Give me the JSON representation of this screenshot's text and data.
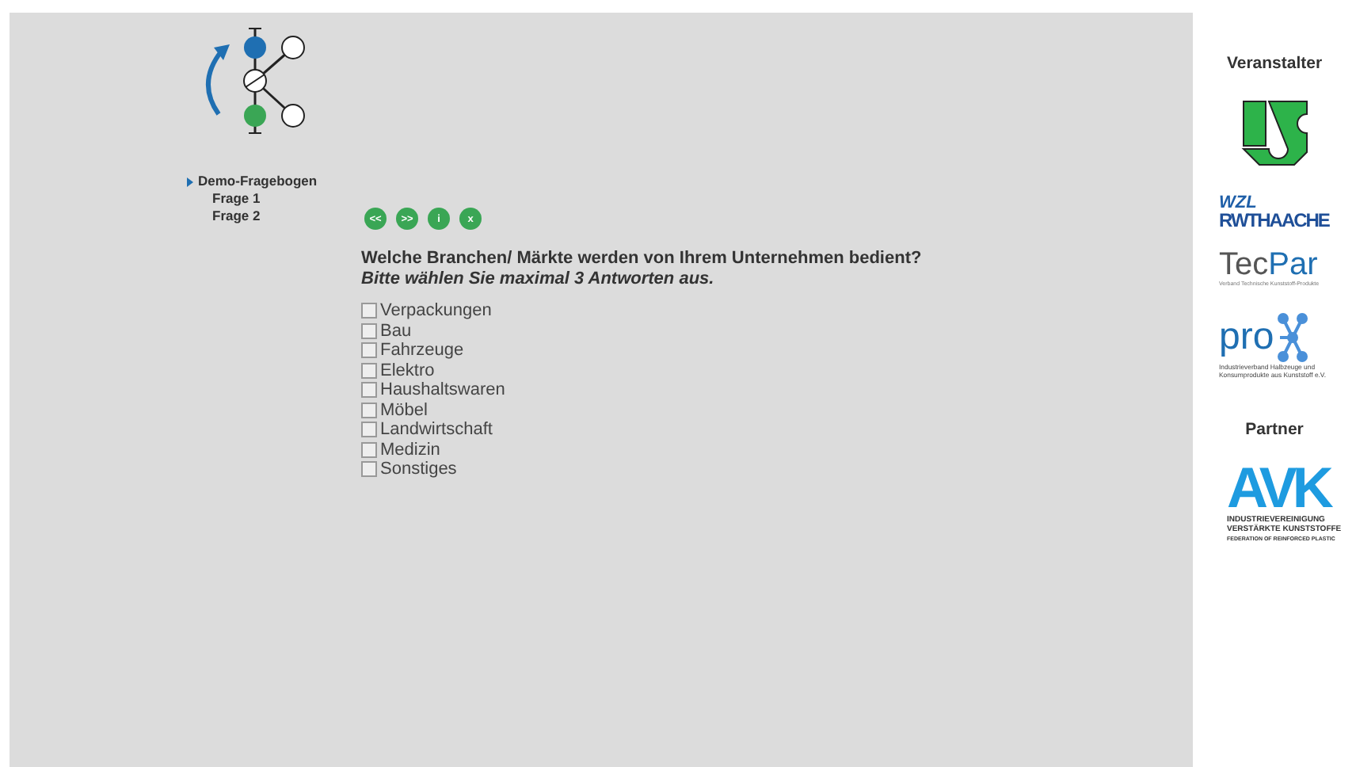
{
  "navigation": {
    "title": "Demo-Fragebogen",
    "expanded": true,
    "children": [
      {
        "label": "Frage 1"
      },
      {
        "label": "Frage 2"
      }
    ]
  },
  "toolbar": [
    "<<",
    ">>",
    "i",
    "x"
  ],
  "question": {
    "text": "Welche Branchen/ Märkte werden von Ihrem Unternehmen bedient?",
    "hint": "Bitte wählen Sie maximal 3 Antworten aus."
  },
  "options": [
    {
      "label": "Verpackungen",
      "checked": false
    },
    {
      "label": "Bau",
      "checked": false
    },
    {
      "label": "Fahrzeuge",
      "checked": false
    },
    {
      "label": "Elektro",
      "checked": false
    },
    {
      "label": "Haushaltswaren",
      "checked": false
    },
    {
      "label": "Möbel",
      "checked": false
    },
    {
      "label": "Landwirtschaft",
      "checked": false
    },
    {
      "label": "Medizin",
      "checked": false
    },
    {
      "label": "Sonstiges",
      "checked": false
    }
  ],
  "sidebar": {
    "organizer_heading": "Veranstalter",
    "wzl": {
      "top": "WZL",
      "bottom": "RWTHAACHE"
    },
    "tecpart": {
      "name_a": "Tec",
      "name_b": "Par",
      "tagline": "Verband Technische Kunststoff-Produkte"
    },
    "pro": {
      "name": "pro",
      "tagline": "Industrieverband Halbzeuge und Konsumprodukte aus Kunststoff e.V."
    },
    "partner_heading": "Partner",
    "avk": {
      "name": "AVK",
      "lines": [
        "INDUSTRIEVEREINIGUNG",
        "VERSTÄRKTE KUNSTSTOFFE",
        "FEDERATION OF REINFORCED PLASTIC"
      ]
    }
  }
}
